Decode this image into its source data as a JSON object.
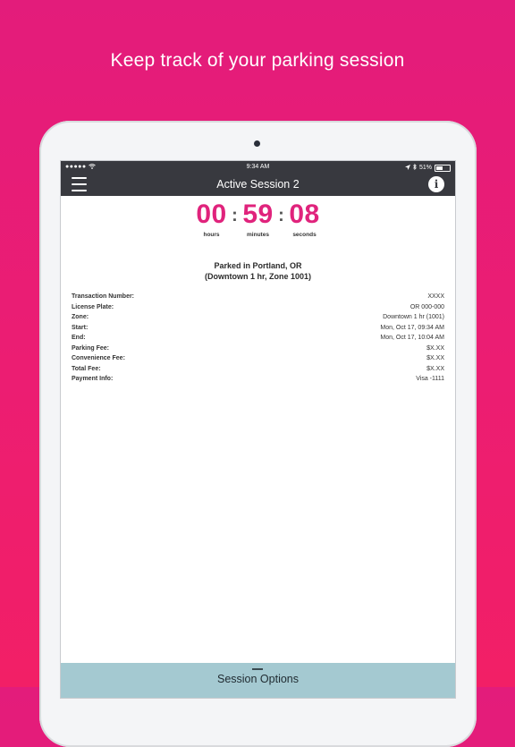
{
  "headline": "Keep track of your parking session",
  "status": {
    "time": "9:34 AM",
    "battery": "51%",
    "battery_fraction": 0.51,
    "signal": "●●●●●"
  },
  "nav": {
    "title": "Active Session 2",
    "info_label": "i"
  },
  "timer": {
    "hours": "00",
    "minutes": "59",
    "seconds": "08",
    "hours_label": "hours",
    "minutes_label": "minutes",
    "seconds_label": "seconds"
  },
  "parked": {
    "line1": "Parked in Portland, OR",
    "line2": "(Downtown 1 hr, Zone 1001)"
  },
  "details": [
    {
      "label": "Transaction Number:",
      "value": "XXXX"
    },
    {
      "label": "License Plate:",
      "value": "OR 000-000"
    },
    {
      "label": "Zone:",
      "value": "Downtown 1 hr (1001)"
    },
    {
      "label": "Start:",
      "value": "Mon, Oct 17, 09:34 AM"
    },
    {
      "label": "End:",
      "value": "Mon, Oct 17, 10:04 AM"
    },
    {
      "label": "Parking Fee:",
      "value": "$X.XX"
    },
    {
      "label": "Convenience Fee:",
      "value": "$X.XX"
    },
    {
      "label": "Total Fee:",
      "value": "$X.XX"
    },
    {
      "label": "Payment Info:",
      "value": "Visa -1111"
    }
  ],
  "bottom": {
    "label": "Session Options"
  },
  "colors": {
    "accent": "#e0237c",
    "navbar": "#38393f",
    "bottom_bar": "#a4c9d1",
    "background": "#ec1d72"
  },
  "icons": {
    "menu": "hamburger-menu-icon",
    "info": "info-icon",
    "wifi": "wifi-icon",
    "location": "location-arrow-icon",
    "bluetooth": "bluetooth-icon",
    "battery": "battery-icon"
  }
}
